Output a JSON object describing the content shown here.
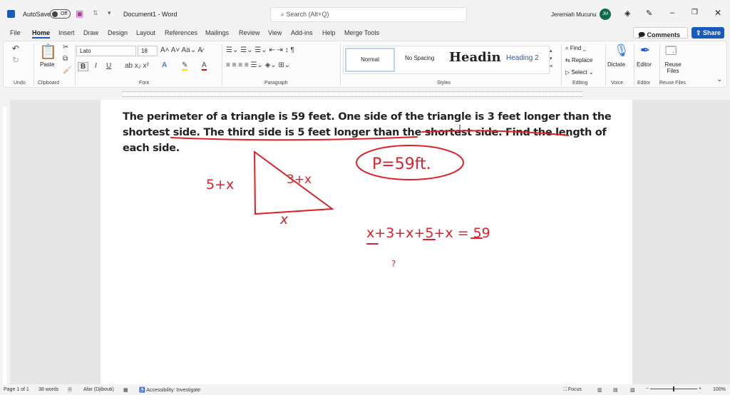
{
  "titlebar": {
    "autosave": "AutoSave",
    "toggle": "Off",
    "doc_title": "Document1  -  Word",
    "search_placeholder": "Search (Alt+Q)",
    "user": "Jeremiah Mucunu",
    "initials": "JM"
  },
  "tabs": [
    "File",
    "Home",
    "Insert",
    "Draw",
    "Design",
    "Layout",
    "References",
    "Mailings",
    "Review",
    "View",
    "Add-ins",
    "Help",
    "Merge Tools"
  ],
  "actions": {
    "comments": "Comments",
    "share": "Share"
  },
  "ribbon": {
    "groups": [
      "Undo",
      "Clipboard",
      "Font",
      "Paragraph",
      "Styles",
      "Editing",
      "Voice",
      "Editor",
      "Reuse Files"
    ],
    "paste": "Paste",
    "font": "Lato",
    "size": "18",
    "styles": [
      "Normal",
      "No Spacing",
      "Headin",
      "Heading 2"
    ],
    "editing": [
      "Find",
      "Replace",
      "Select"
    ],
    "dictate": "Dictate",
    "editor": "Editor",
    "reuse": "Reuse Files"
  },
  "document": {
    "text": "The perimeter of a triangle is 59 feet. One side of the triangle is 3 feet longer than the shortest side. The third side is 5 feet longer than the shortest side. Find the length of each side.",
    "handwriting": [
      "5+x",
      "3+x",
      "x",
      "P=59ft.",
      "x+3+x+5+x = 59",
      "?"
    ]
  },
  "status": {
    "page": "Page 1 of 1",
    "words": "38 words",
    "language": "Afar (Djibouti)",
    "accessibility": "Accessibility: Investigate",
    "focus": "Focus",
    "zoom": "100%"
  },
  "colors": {
    "accent": "#185abd",
    "ink": "#e0202a",
    "avatar": "#0e6b4a"
  }
}
